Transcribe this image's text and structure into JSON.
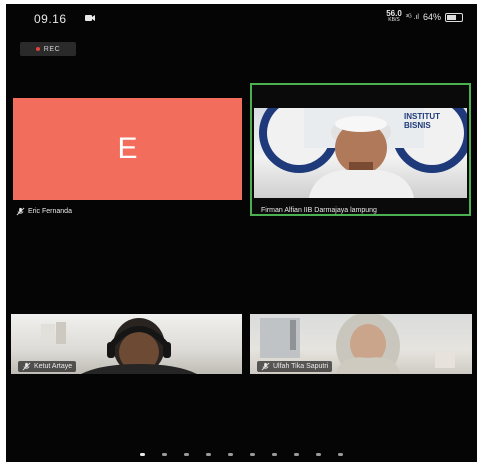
{
  "statusbar": {
    "time": "09.16",
    "net_speed": "56.0",
    "net_unit": "KB/S",
    "signal": "³ᴳ .ıl",
    "battery": "64%",
    "battery_level": 0.64
  },
  "recording": {
    "label": "REC"
  },
  "participants": [
    {
      "name": "Eric Fernanda",
      "avatar_letter": "E",
      "avatar_color": "#f36d5c",
      "video": false,
      "active_speaker": false
    },
    {
      "name": "Firman Alfian IIB Darmajaya lampung",
      "video": true,
      "active_speaker": true,
      "banner_text": "INSTITUT BISNIS"
    },
    {
      "name": "Ketut Artaye",
      "video": true,
      "active_speaker": false
    },
    {
      "name": "Ulfah Tika Saputri",
      "video": true,
      "active_speaker": false
    }
  ],
  "pager": {
    "page_count": 10,
    "current": 1
  },
  "colors": {
    "active_border": "#4caf50",
    "rec_dot": "#e0433b"
  }
}
